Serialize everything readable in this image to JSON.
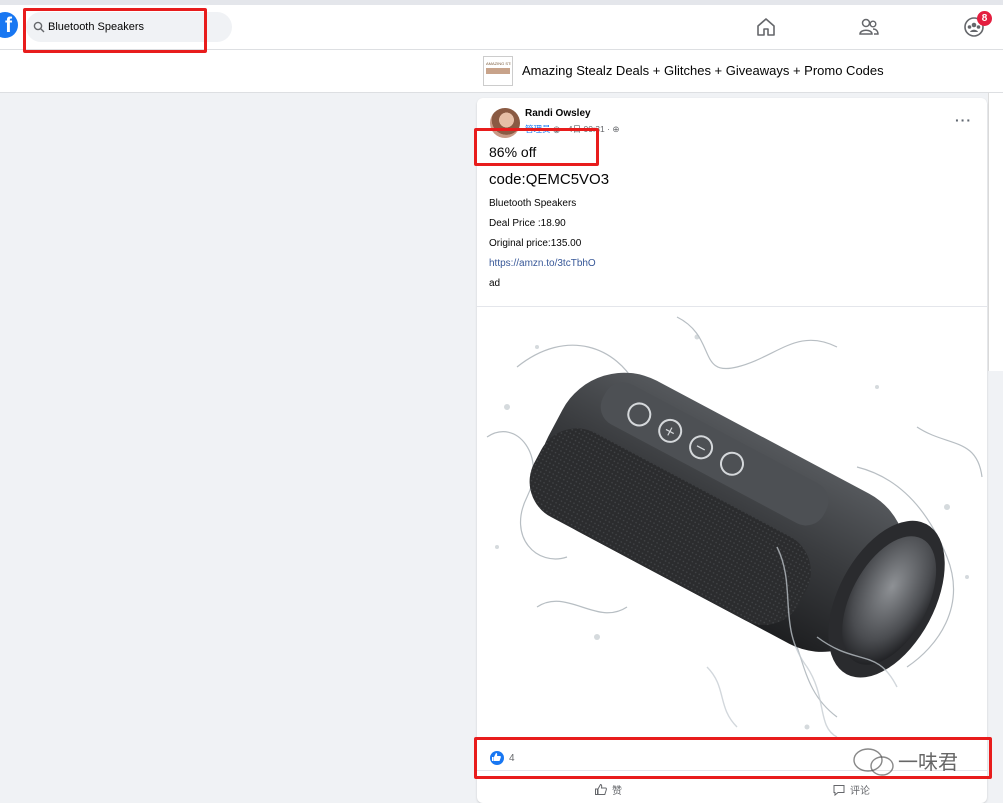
{
  "search": {
    "value": "Bluetooth Speakers"
  },
  "nav": {
    "notification_count": "8"
  },
  "group": {
    "thumb_text": "AMAZING STE",
    "title": "Amazing Stealz Deals + Glitches + Giveaways + Promo Codes"
  },
  "post": {
    "author": "Randi Owsley",
    "role": "管理员",
    "date": "4日 00:31 ·",
    "discount": "86% off",
    "code": "code:QEMC5VO3",
    "lines": [
      "Bluetooth Speakers",
      "Deal Price :18.90",
      "Original price:135.00"
    ],
    "link": "https://amzn.to/3tcTbhO",
    "tag": "ad",
    "reaction_count": "4",
    "actions": {
      "like": "赞",
      "comment": "评论"
    }
  },
  "watermark": {
    "text": "一味君"
  }
}
